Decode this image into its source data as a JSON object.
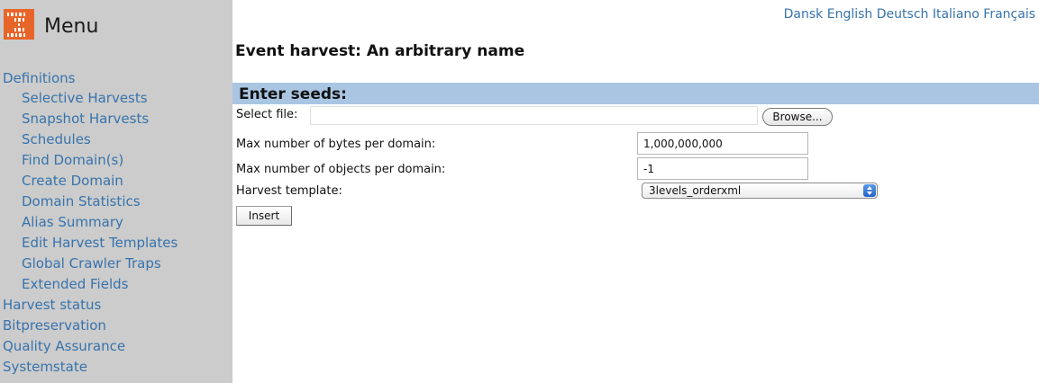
{
  "sidebar": {
    "logo_icon": "binary-logo-icon",
    "logo_color": "#e8652a",
    "menu_title": "Menu",
    "items": [
      {
        "label": "Definitions",
        "level": "top"
      },
      {
        "label": "Selective Harvests",
        "level": "sub"
      },
      {
        "label": "Snapshot Harvests",
        "level": "sub"
      },
      {
        "label": "Schedules",
        "level": "sub"
      },
      {
        "label": "Find Domain(s)",
        "level": "sub"
      },
      {
        "label": "Create Domain",
        "level": "sub"
      },
      {
        "label": "Domain Statistics",
        "level": "sub"
      },
      {
        "label": "Alias Summary",
        "level": "sub"
      },
      {
        "label": "Edit Harvest Templates",
        "level": "sub"
      },
      {
        "label": "Global Crawler Traps",
        "level": "sub"
      },
      {
        "label": "Extended Fields",
        "level": "sub"
      },
      {
        "label": "Harvest status",
        "level": "top"
      },
      {
        "label": "Bitpreservation",
        "level": "top"
      },
      {
        "label": "Quality Assurance",
        "level": "top"
      },
      {
        "label": "Systemstate",
        "level": "top"
      }
    ]
  },
  "languages": [
    "Dansk",
    "English",
    "Deutsch",
    "Italiano",
    "Français"
  ],
  "page_title": "Event harvest: An arbitrary name",
  "section": {
    "header": "Enter seeds:",
    "select_file_label": "Select file:",
    "browse_label": "Browse...",
    "max_bytes_label": "Max number of bytes per domain:",
    "max_bytes_value": "1,000,000,000",
    "max_objects_label": "Max number of objects per domain:",
    "max_objects_value": "-1",
    "template_label": "Harvest template:",
    "template_value": "3levels_orderxml",
    "insert_label": "Insert"
  },
  "colors": {
    "sidebar_bg": "#cccccc",
    "link": "#3773ac",
    "section_header_bg": "#a9c5e2"
  }
}
